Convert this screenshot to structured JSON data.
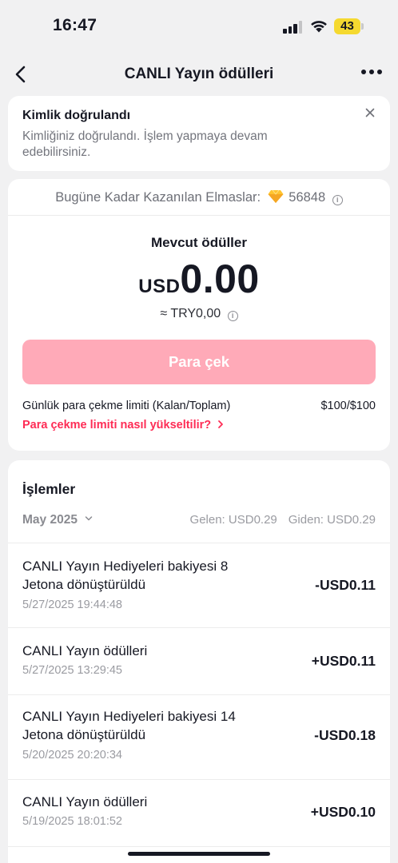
{
  "status_bar": {
    "time": "16:47",
    "battery": "43"
  },
  "nav": {
    "title": "CANLI Yayın ödülleri"
  },
  "verification": {
    "title": "Kimlik doğrulandı",
    "text": "Kimliğiniz doğrulandı. İşlem yapmaya devam edebilirsiniz."
  },
  "earnings": {
    "diamonds_label": "Bugüne Kadar Kazanılan Elmaslar:",
    "diamonds_value": "56848",
    "available_label": "Mevcut ödüller",
    "currency": "USD",
    "amount": "0.00",
    "approx": "≈ TRY0,00",
    "withdraw_label": "Para çek",
    "limit_label": "Günlük para çekme limiti (Kalan/Toplam)",
    "limit_value": "$100/$100",
    "limit_link": "Para çekme limiti nasıl yükseltilir?"
  },
  "transactions": {
    "title": "İşlemler",
    "month": "May 2025",
    "incoming": "Gelen: USD0.29",
    "outgoing": "Giden: USD0.29",
    "items": [
      {
        "desc": "CANLI Yayın Hediyeleri bakiyesi 8 Jetona dönüştürüldü",
        "date": "5/27/2025 19:44:48",
        "amount": "-USD0.11"
      },
      {
        "desc": "CANLI Yayın ödülleri",
        "date": "5/27/2025 13:29:45",
        "amount": "+USD0.11"
      },
      {
        "desc": "CANLI Yayın Hediyeleri bakiyesi 14 Jetona dönüştürüldü",
        "date": "5/20/2025 20:20:34",
        "amount": "-USD0.18"
      },
      {
        "desc": "CANLI Yayın ödülleri",
        "date": "5/19/2025 18:01:52",
        "amount": "+USD0.10"
      }
    ]
  },
  "colors": {
    "accent": "#fe2c55",
    "button_disabled": "#ffaab8",
    "background": "#f1f1f2",
    "battery": "#f5d930"
  },
  "icons": [
    "signal-icon",
    "wifi-icon",
    "battery-icon",
    "back-arrow-icon",
    "more-icon",
    "close-icon",
    "diamond-icon",
    "info-icon",
    "chevron-down-icon",
    "chevron-right-icon"
  ]
}
